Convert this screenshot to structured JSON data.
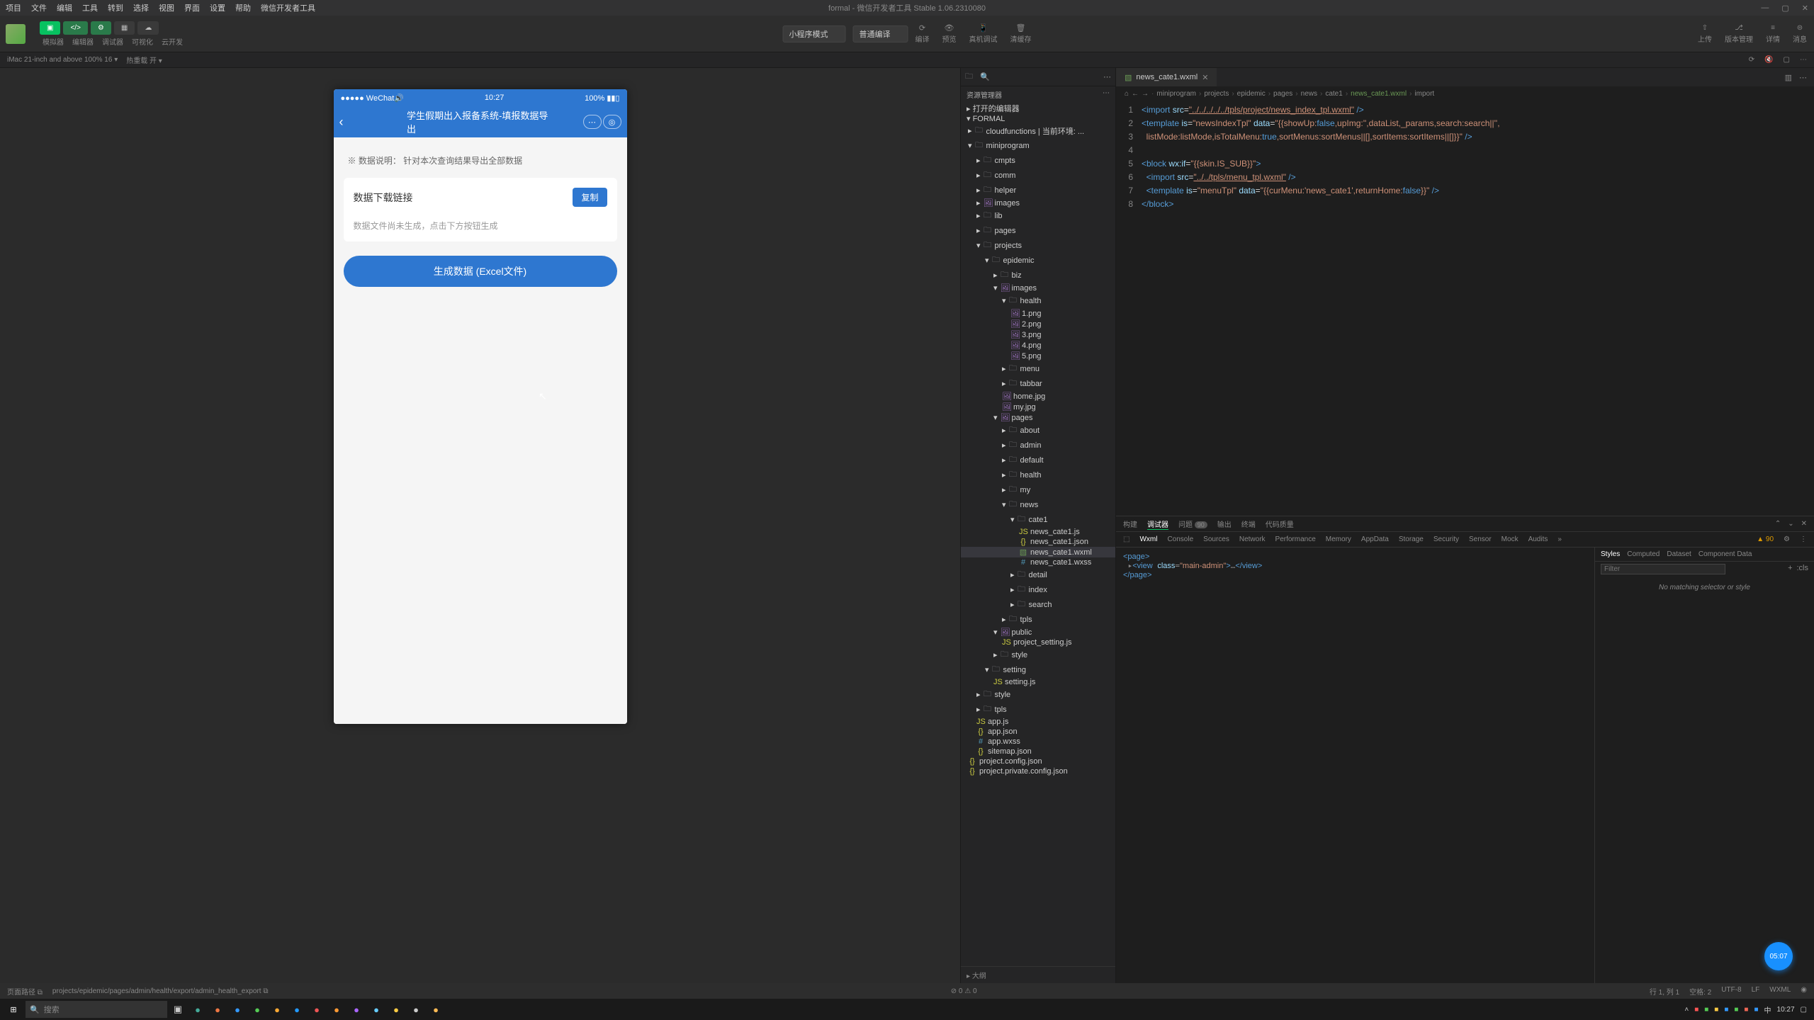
{
  "menubar": {
    "items": [
      "项目",
      "文件",
      "编辑",
      "工具",
      "转到",
      "选择",
      "视图",
      "界面",
      "设置",
      "帮助",
      "微信开发者工具"
    ],
    "title": "formal - 微信开发者工具 Stable 1.06.2310080"
  },
  "toolbar": {
    "modes": [
      "模拟器",
      "编辑器",
      "调试器",
      "可视化",
      "云开发"
    ],
    "selects": {
      "mode": "小程序模式",
      "compile": "普通编译"
    },
    "centerLabels": [
      "编译",
      "预览",
      "真机调试",
      "清缓存"
    ],
    "right": [
      "上传",
      "版本管理",
      "详情",
      "消息"
    ]
  },
  "devbar": {
    "left": "iMac 21-inch and above 100% 16 ▾",
    "mid": "热重载 开 ▾"
  },
  "phone": {
    "status": {
      "carrier": "●●●●● WeChat🔊",
      "time": "10:27",
      "batt": "100% ▮▮▯"
    },
    "nav": {
      "title": "学生假期出入报备系统-填报数据导出"
    },
    "note": "※ 数据说明： 针对本次查询结果导出全部数据",
    "card": {
      "label": "数据下载链接",
      "copy": "复制",
      "hint": "数据文件尚未生成，点击下方按钮生成"
    },
    "gen": "生成数据 (Excel文件)"
  },
  "filetree": {
    "header": "资源管理器",
    "sections": {
      "opened": "打开的编辑器",
      "root": "FORMAL",
      "outline": "大纲"
    },
    "nodes": [
      {
        "d": 0,
        "t": "f",
        "ic": "fold",
        "n": "cloudfunctions | 当前环境: ..."
      },
      {
        "d": 0,
        "t": "f",
        "ic": "fold",
        "n": "miniprogram",
        "open": true
      },
      {
        "d": 1,
        "t": "f",
        "ic": "fold",
        "n": "cmpts"
      },
      {
        "d": 1,
        "t": "f",
        "ic": "fold",
        "n": "comm"
      },
      {
        "d": 1,
        "t": "f",
        "ic": "fold",
        "n": "helper"
      },
      {
        "d": 1,
        "t": "f",
        "ic": "fimg",
        "n": "images"
      },
      {
        "d": 1,
        "t": "f",
        "ic": "fold",
        "n": "lib"
      },
      {
        "d": 1,
        "t": "f",
        "ic": "fold",
        "n": "pages"
      },
      {
        "d": 1,
        "t": "f",
        "ic": "fold",
        "n": "projects",
        "open": true
      },
      {
        "d": 2,
        "t": "f",
        "ic": "fold",
        "n": "epidemic",
        "open": true
      },
      {
        "d": 3,
        "t": "f",
        "ic": "fold",
        "n": "biz"
      },
      {
        "d": 3,
        "t": "f",
        "ic": "fimg",
        "n": "images",
        "open": true
      },
      {
        "d": 4,
        "t": "f",
        "ic": "fold",
        "n": "health",
        "open": true
      },
      {
        "d": 5,
        "t": "i",
        "ic": "fimg",
        "n": "1.png"
      },
      {
        "d": 5,
        "t": "i",
        "ic": "fimg",
        "n": "2.png"
      },
      {
        "d": 5,
        "t": "i",
        "ic": "fimg",
        "n": "3.png"
      },
      {
        "d": 5,
        "t": "i",
        "ic": "fimg",
        "n": "4.png"
      },
      {
        "d": 5,
        "t": "i",
        "ic": "fimg",
        "n": "5.png"
      },
      {
        "d": 4,
        "t": "f",
        "ic": "fold",
        "n": "menu"
      },
      {
        "d": 4,
        "t": "f",
        "ic": "fold",
        "n": "tabbar"
      },
      {
        "d": 4,
        "t": "i",
        "ic": "fimg",
        "n": "home.jpg"
      },
      {
        "d": 4,
        "t": "i",
        "ic": "fimg",
        "n": "my.jpg"
      },
      {
        "d": 3,
        "t": "f",
        "ic": "fimg",
        "n": "pages",
        "open": true
      },
      {
        "d": 4,
        "t": "f",
        "ic": "fold",
        "n": "about"
      },
      {
        "d": 4,
        "t": "f",
        "ic": "fold",
        "n": "admin"
      },
      {
        "d": 4,
        "t": "f",
        "ic": "fold",
        "n": "default"
      },
      {
        "d": 4,
        "t": "f",
        "ic": "fold",
        "n": "health"
      },
      {
        "d": 4,
        "t": "f",
        "ic": "fold",
        "n": "my"
      },
      {
        "d": 4,
        "t": "f",
        "ic": "fold",
        "n": "news",
        "open": true
      },
      {
        "d": 5,
        "t": "f",
        "ic": "fold",
        "n": "cate1",
        "open": true
      },
      {
        "d": 6,
        "t": "i",
        "ic": "fjs",
        "n": "news_cate1.js"
      },
      {
        "d": 6,
        "t": "i",
        "ic": "fjson",
        "n": "news_cate1.json"
      },
      {
        "d": 6,
        "t": "i",
        "ic": "fwxml",
        "n": "news_cate1.wxml",
        "sel": true
      },
      {
        "d": 6,
        "t": "i",
        "ic": "fwxss",
        "n": "news_cate1.wxss"
      },
      {
        "d": 5,
        "t": "f",
        "ic": "fold",
        "n": "detail"
      },
      {
        "d": 5,
        "t": "f",
        "ic": "fold",
        "n": "index"
      },
      {
        "d": 5,
        "t": "f",
        "ic": "fold",
        "n": "search"
      },
      {
        "d": 4,
        "t": "f",
        "ic": "fold",
        "n": "tpls"
      },
      {
        "d": 3,
        "t": "f",
        "ic": "fimg",
        "n": "public",
        "open": true
      },
      {
        "d": 4,
        "t": "i",
        "ic": "fjs",
        "n": "project_setting.js"
      },
      {
        "d": 3,
        "t": "f",
        "ic": "fold",
        "n": "style"
      },
      {
        "d": 2,
        "t": "f",
        "ic": "fold",
        "n": "setting",
        "open": true
      },
      {
        "d": 3,
        "t": "i",
        "ic": "fjs",
        "n": "setting.js"
      },
      {
        "d": 1,
        "t": "f",
        "ic": "fold",
        "n": "style"
      },
      {
        "d": 1,
        "t": "f",
        "ic": "fold",
        "n": "tpls"
      },
      {
        "d": 1,
        "t": "i",
        "ic": "fjs",
        "n": "app.js"
      },
      {
        "d": 1,
        "t": "i",
        "ic": "fjson",
        "n": "app.json"
      },
      {
        "d": 1,
        "t": "i",
        "ic": "fwxss",
        "n": "app.wxss"
      },
      {
        "d": 1,
        "t": "i",
        "ic": "fjson",
        "n": "sitemap.json"
      },
      {
        "d": 0,
        "t": "i",
        "ic": "fjson",
        "n": "project.config.json"
      },
      {
        "d": 0,
        "t": "i",
        "ic": "fjson",
        "n": "project.private.config.json"
      }
    ]
  },
  "editor": {
    "tab": "news_cate1.wxml",
    "crumbs": [
      "miniprogram",
      "projects",
      "epidemic",
      "pages",
      "news",
      "cate1",
      "news_cate1.wxml",
      "import"
    ],
    "lines": [
      {
        "n": 1,
        "html": "<span class='c-tag'>&lt;import</span> <span class='c-attr'>src</span>=<span class='c-path'>\"../../../../../tpls/project/news_index_tpl.wxml\"</span> <span class='c-tag'>/&gt;</span>"
      },
      {
        "n": 2,
        "html": "<span class='c-tag'>&lt;template</span> <span class='c-attr'>is</span>=<span class='c-str'>\"newsIndexTpl\"</span> <span class='c-attr'>data</span>=<span class='c-str'>\"{{showUp:</span><span class='c-bool'>false</span><span class='c-str'>,upImg:'',dataList,_params,search:search||'',</span>"
      },
      {
        "n": 3,
        "html": "  <span class='c-str'>listMode:listMode,isTotalMenu:</span><span class='c-bool'>true</span><span class='c-str'>,sortMenus:sortMenus||[],sortItems:sortItems||[]}}\"</span> <span class='c-tag'>/&gt;</span>"
      },
      {
        "n": 4,
        "html": ""
      },
      {
        "n": 5,
        "html": "<span class='c-tag'>&lt;block</span> <span class='c-attr'>wx:if</span>=<span class='c-str'>\"{{skin.IS_SUB}}\"</span><span class='c-tag'>&gt;</span>"
      },
      {
        "n": 6,
        "html": "  <span class='c-tag'>&lt;import</span> <span class='c-attr'>src</span>=<span class='c-path'>\"../../tpls/menu_tpl.wxml\"</span> <span class='c-tag'>/&gt;</span>"
      },
      {
        "n": 7,
        "html": "  <span class='c-tag'>&lt;template</span> <span class='c-attr'>is</span>=<span class='c-str'>\"menuTpl\"</span> <span class='c-attr'>data</span>=<span class='c-str'>\"{{curMenu:'news_cate1',returnHome:</span><span class='c-bool'>false</span><span class='c-str'>}}\"</span> <span class='c-tag'>/&gt;</span>"
      },
      {
        "n": 8,
        "html": "<span class='c-tag'>&lt;/block&gt;</span>"
      }
    ]
  },
  "devtools": {
    "tabsA": [
      "构建",
      "调试器",
      "问题",
      "输出",
      "终端",
      "代码质量"
    ],
    "badge": "90",
    "tabsB": [
      "Wxml",
      "Console",
      "Sources",
      "Network",
      "Performance",
      "Memory",
      "AppData",
      "Storage",
      "Security",
      "Sensor",
      "Mock",
      "Audits"
    ],
    "warn": "▲ 90",
    "dom": "<page>\n ▸<view class=\"main-admin\">…</view>\n</page>",
    "stabs": [
      "Styles",
      "Computed",
      "Dataset",
      "Component Data"
    ],
    "filter": "Filter",
    "cls": ":cls",
    "msg": "No matching selector or style"
  },
  "status": {
    "left": [
      "页面路径 ⧉",
      "projects/epidemic/pages/admin/health/export/admin_health_export ⧉"
    ],
    "left2": [
      "⊘ 0  ⚠ 0"
    ],
    "right": [
      "行 1, 列 1",
      "空格: 2",
      "UTF-8",
      "LF",
      "WXML",
      "◉"
    ]
  },
  "taskbar": {
    "search": "搜索",
    "time": "10:27"
  },
  "timer": "05:07"
}
